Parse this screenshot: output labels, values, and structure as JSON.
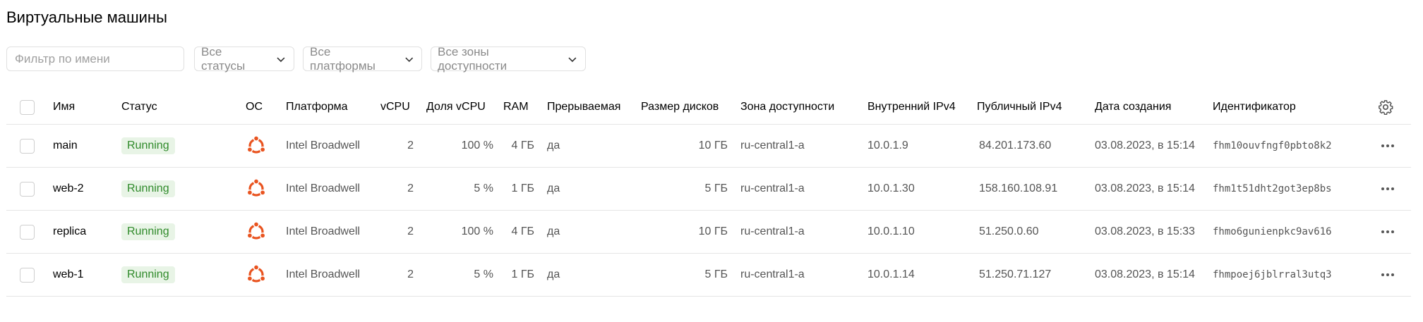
{
  "page": {
    "title": "Виртуальные машины"
  },
  "filters": {
    "name_placeholder": "Фильтр по имени",
    "status": "Все статусы",
    "platform": "Все платформы",
    "zone": "Все зоны доступности"
  },
  "columns": {
    "name": "Имя",
    "status": "Статус",
    "os": "ОС",
    "platform": "Платформа",
    "vcpu": "vCPU",
    "vcpu_share": "Доля vCPU",
    "ram": "RAM",
    "preemptible": "Прерываемая",
    "disk_size": "Размер дисков",
    "zone": "Зона доступности",
    "internal_ip": "Внутренний IPv4",
    "public_ip": "Публичный IPv4",
    "created": "Дата создания",
    "id": "Идентификатор"
  },
  "rows": [
    {
      "name": "main",
      "status": "Running",
      "os_icon": "ubuntu-icon",
      "platform": "Intel Broadwell",
      "vcpu": "2",
      "vcpu_share": "100 %",
      "ram": "4 ГБ",
      "preemptible": "да",
      "disk_size": "10 ГБ",
      "zone": "ru-central1-a",
      "internal_ip": "10.0.1.9",
      "public_ip": "84.201.173.60",
      "created": "03.08.2023, в 15:14",
      "id": "fhm10ouvfngf0pbto8k2"
    },
    {
      "name": "web-2",
      "status": "Running",
      "os_icon": "ubuntu-icon",
      "platform": "Intel Broadwell",
      "vcpu": "2",
      "vcpu_share": "5 %",
      "ram": "1 ГБ",
      "preemptible": "да",
      "disk_size": "5 ГБ",
      "zone": "ru-central1-a",
      "internal_ip": "10.0.1.30",
      "public_ip": "158.160.108.91",
      "created": "03.08.2023, в 15:14",
      "id": "fhm1t51dht2got3ep8bs"
    },
    {
      "name": "replica",
      "status": "Running",
      "os_icon": "ubuntu-icon",
      "platform": "Intel Broadwell",
      "vcpu": "2",
      "vcpu_share": "100 %",
      "ram": "4 ГБ",
      "preemptible": "да",
      "disk_size": "10 ГБ",
      "zone": "ru-central1-a",
      "internal_ip": "10.0.1.10",
      "public_ip": "51.250.0.60",
      "created": "03.08.2023, в 15:33",
      "id": "fhmo6gunienpkc9av616"
    },
    {
      "name": "web-1",
      "status": "Running",
      "os_icon": "ubuntu-icon",
      "platform": "Intel Broadwell",
      "vcpu": "2",
      "vcpu_share": "5 %",
      "ram": "1 ГБ",
      "preemptible": "да",
      "disk_size": "5 ГБ",
      "zone": "ru-central1-a",
      "internal_ip": "10.0.1.14",
      "public_ip": "51.250.71.127",
      "created": "03.08.2023, в 15:14",
      "id": "fhmpoej6jblrral3utq3"
    }
  ],
  "colors": {
    "status_running_bg": "#e8f4e6",
    "status_running_text": "#2f8a2a",
    "ubuntu_orange": "#e95420"
  }
}
